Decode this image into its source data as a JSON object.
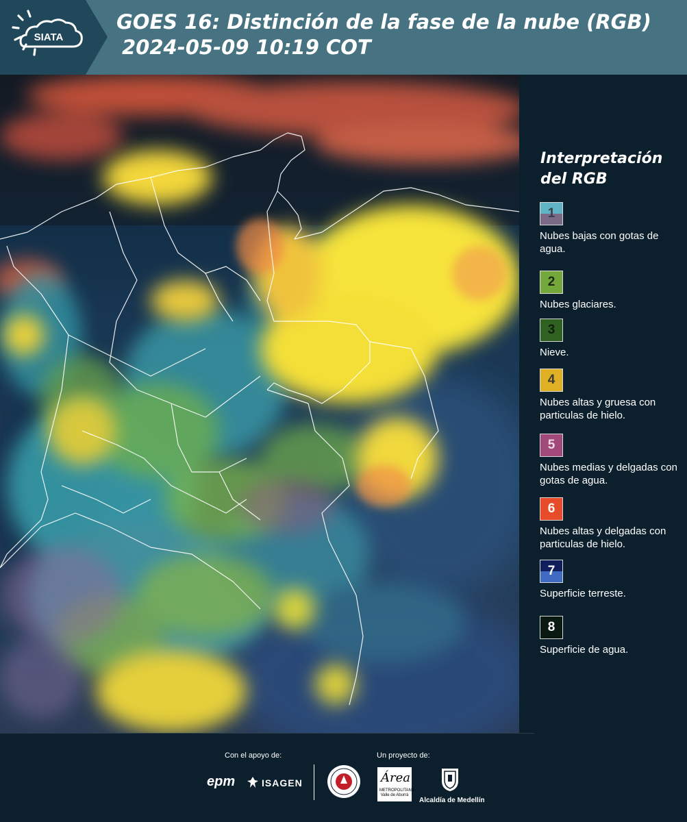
{
  "header": {
    "logo_text": "SIATA",
    "title_line1": "GOES 16: Distinción de la fase de la nube (RGB)",
    "title_line2": "2024-05-09 10:19 COT",
    "background_color": "#477282"
  },
  "legend": {
    "title": "Interpretación del RGB",
    "items": [
      {
        "number": "1",
        "label": "Nubes bajas con gotas de agua.",
        "color_top": "#5fb3c4",
        "color_bottom": "#7b6a86",
        "number_color": "#3d3d48"
      },
      {
        "number": "2",
        "label": "Nubes glaciares.",
        "color_top": "#74a83a",
        "color_bottom": "#74a83a",
        "number_color": "#1c2a12"
      },
      {
        "number": "3",
        "label": "Nieve.",
        "color_top": "#2f6221",
        "color_bottom": "#2f6221",
        "number_color": "#0f1f0a"
      },
      {
        "number": "4",
        "label": "Nubes altas y gruesa con particulas de hielo.",
        "color_top": "#e0b024",
        "color_bottom": "#e0b024",
        "number_color": "#3a3a3a"
      },
      {
        "number": "5",
        "label": "Nubes medias y delgadas con gotas de agua.",
        "color_top": "#a0497a",
        "color_bottom": "#a0497a",
        "number_color": "#f1d8e6"
      },
      {
        "number": "6",
        "label": "Nubes altas y delgadas con particulas de hielo.",
        "color_top": "#e84b2a",
        "color_bottom": "#e84b2a",
        "number_color": "#ffffff"
      },
      {
        "number": "7",
        "label": "Superficie terreste.",
        "color_top": "#101e5c",
        "color_bottom": "#3f6bc3",
        "number_color": "#ffffff"
      },
      {
        "number": "8",
        "label": "Superficie de agua.",
        "color_top": "#0a1a12",
        "color_bottom": "#0a1a12",
        "number_color": "#ffffff"
      }
    ]
  },
  "footer": {
    "support_caption": "Con el apoyo de:",
    "project_caption": "Un proyecto de:",
    "epm_text": "epm",
    "isagen_text": "ISAGEN",
    "area_text": "Área",
    "area_subtext": "METROPOLITANA Valle de Aburrá",
    "alcaldia_text": "Alcaldía de Medellín"
  }
}
